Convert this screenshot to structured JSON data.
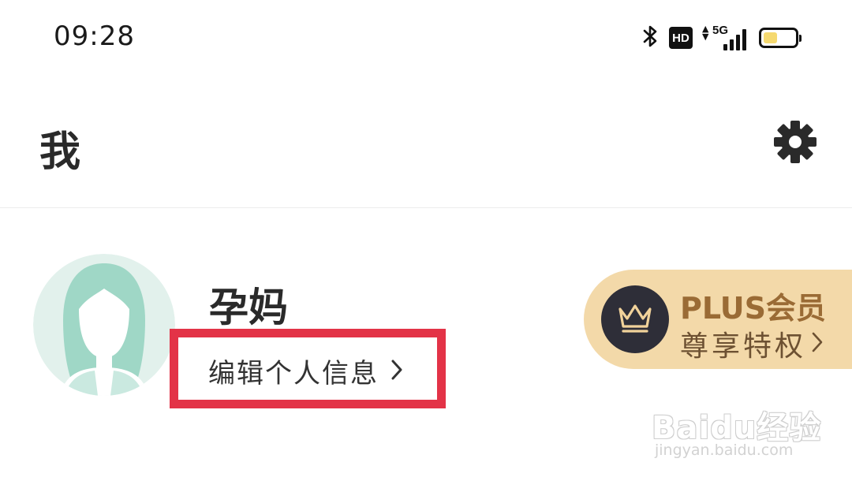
{
  "status_bar": {
    "time": "09:28",
    "hd_label": "HD",
    "network_label": "5G",
    "battery_level": 0.45,
    "battery_color": "#f5d970"
  },
  "header": {
    "title": "我",
    "settings_icon": "gear-icon"
  },
  "profile": {
    "nickname": "孕妈",
    "edit_label": "编辑个人信息",
    "avatar_icon": "female-avatar-icon",
    "highlight_color": "#e33347"
  },
  "plus": {
    "title": "PLUS会员",
    "subtitle": "尊享特权",
    "icon": "crown-icon",
    "card_color": "#f3d9a9"
  },
  "watermark": {
    "brand": "Baidu经验",
    "url": "jingyan.baidu.com"
  }
}
